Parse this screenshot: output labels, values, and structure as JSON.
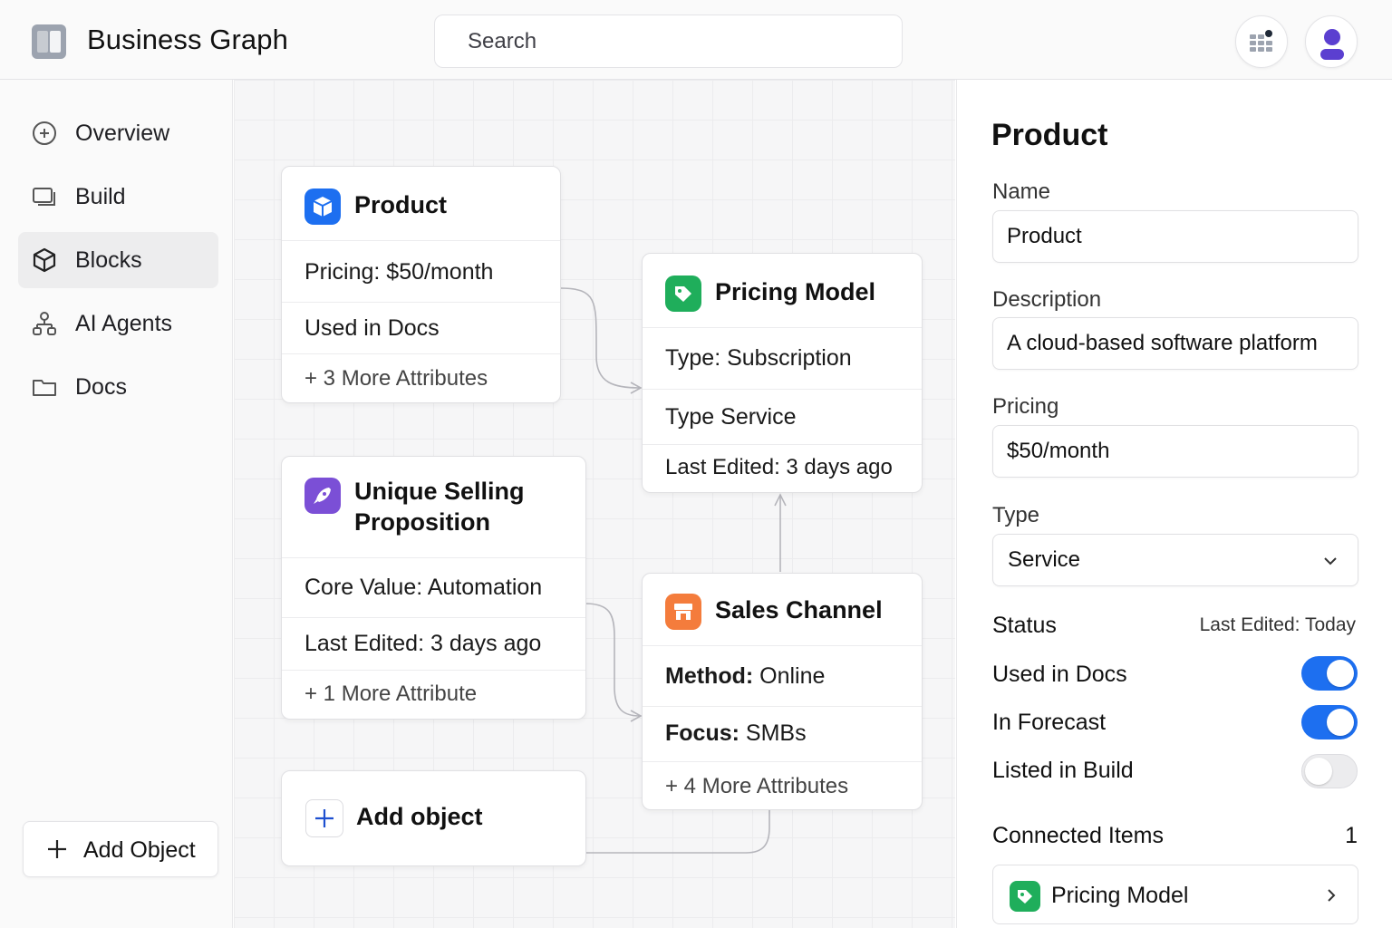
{
  "header": {
    "app_title": "Business Graph",
    "search_placeholder": "Search",
    "icons": [
      "apps-grid-icon",
      "user-avatar-icon"
    ]
  },
  "sidebar": {
    "items": [
      {
        "label": "Overview",
        "icon": "plus-circle-icon",
        "active": false
      },
      {
        "label": "Build",
        "icon": "build-icon",
        "active": false
      },
      {
        "label": "Blocks",
        "icon": "cube-icon",
        "active": true
      },
      {
        "label": "AI Agents",
        "icon": "agents-icon",
        "active": false
      },
      {
        "label": "Docs",
        "icon": "folder-icon",
        "active": false
      }
    ],
    "add_button_label": "Add Object"
  },
  "canvas": {
    "cards": {
      "product": {
        "title": "Product",
        "rows": [
          "Pricing: $50/month",
          "Used in Docs",
          "+ 3 More Attributes"
        ],
        "color": "#1d6ff0"
      },
      "usp": {
        "title_line1": "Unique Selling",
        "title_line2": "Proposition",
        "rows": [
          "Core Value: Automation",
          "Last Edited: 3 days ago",
          "+ 1 More Attribute"
        ],
        "color": "#7b4fd6"
      },
      "add": {
        "title": "Add object"
      },
      "pricing_model": {
        "title": "Pricing Model",
        "rows": [
          "Type: Subscription",
          "Type Service",
          "Last Edited: 3 days ago"
        ],
        "color": "#1fae5b"
      },
      "sales_channel": {
        "title": "Sales Channel",
        "row1_key": "Method:",
        "row1_val": " Online",
        "row2_key": "Focus:",
        "row2_val": " SMBs",
        "more": "+ 4 More Attributes",
        "color": "#f47c3c"
      }
    }
  },
  "panel": {
    "title": "Product",
    "fields": {
      "name_label": "Name",
      "name_value": "Product",
      "description_label": "Description",
      "description_value": "A cloud-based software platform",
      "pricing_label": "Pricing",
      "pricing_value": "$50/month",
      "type_label": "Type",
      "type_value": "Service"
    },
    "status_label": "Status",
    "status_edited": "Last Edited: Today",
    "toggles": [
      {
        "label": "Used in Docs",
        "on": true
      },
      {
        "label": "In Forecast",
        "on": true
      },
      {
        "label": "Listed in Build",
        "on": false
      }
    ],
    "connected_label": "Connected Items",
    "connected_count": "1",
    "connected_item": "Pricing Model",
    "accent_color": "#1d6ff0"
  }
}
